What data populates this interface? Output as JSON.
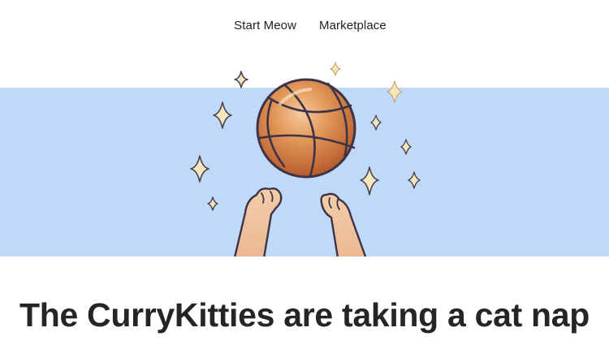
{
  "nav": {
    "items": [
      {
        "label": "Start Meow"
      },
      {
        "label": "Marketplace"
      }
    ]
  },
  "hero": {
    "background_color": "#bfdaf8",
    "illustration": {
      "objects": [
        "basketball-icon",
        "cat-paw-left-icon",
        "cat-paw-right-icon",
        "sparkle-icon"
      ],
      "ball_color": "#c8733a",
      "paw_color": "#f0c7a4",
      "sparkle_color": "#f3e2b6"
    }
  },
  "headline": "The CurryKitties are taking a cat nap"
}
